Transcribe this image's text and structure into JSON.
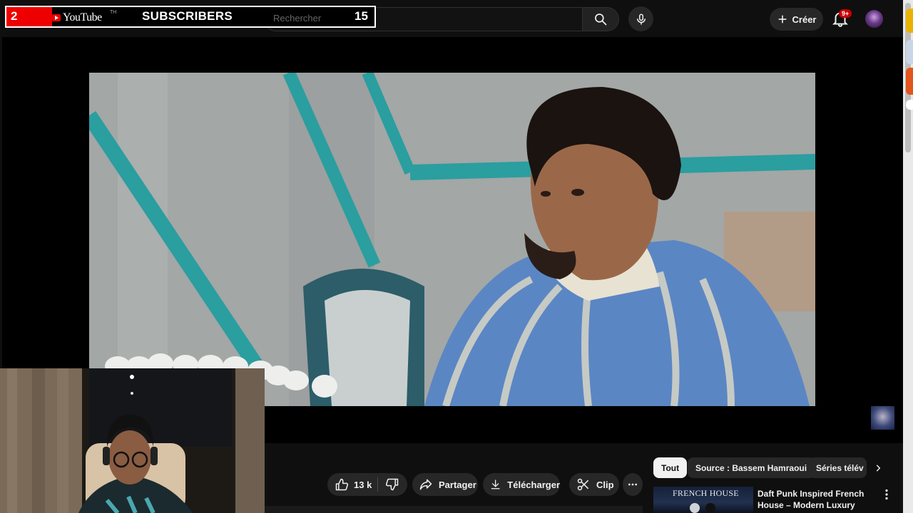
{
  "masthead": {
    "search_placeholder": "Rechercher",
    "create_label": "Créer",
    "notifications_badge": "9+"
  },
  "subscriber_overlay": {
    "left_count": "2",
    "logo_text": "YouTube",
    "tm": "TH",
    "title": "SUBSCRIBERS",
    "right_count": "15"
  },
  "actions": {
    "likes": "13 k",
    "share": "Partager",
    "download": "Télécharger",
    "clip": "Clip"
  },
  "chips": [
    {
      "label": "Tout",
      "active": true
    },
    {
      "label": "Source : Bassem Hamraoui",
      "active": false
    },
    {
      "label": "Séries télév",
      "active": false
    }
  ],
  "suggestion": {
    "thumb_text": "FRENCH HOUSE",
    "title": "Daft Punk Inspired French House – Modern Luxury Groov..."
  },
  "icons": [
    "search-icon",
    "mic-icon",
    "plus-icon",
    "bell-icon",
    "thumb-up-icon",
    "thumb-down-icon",
    "share-icon",
    "download-icon",
    "scissors-icon",
    "more-horizontal-icon",
    "chevron-right-icon",
    "vertical-dots-icon"
  ],
  "colors": {
    "background": "#0f0f0f",
    "pill": "#272727",
    "brand_red": "#ee0000",
    "badge_red": "#cc0000"
  }
}
